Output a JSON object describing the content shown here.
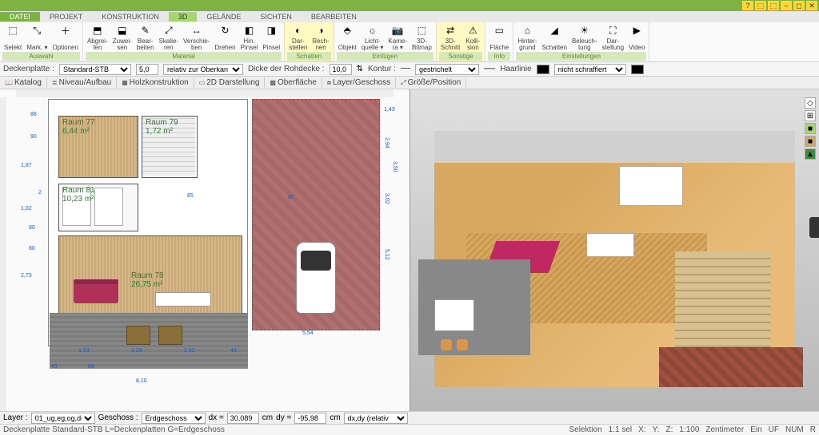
{
  "window_buttons": [
    "–",
    "◻",
    "✕"
  ],
  "menu_tabs": [
    {
      "label": "DATEI",
      "cls": "datei"
    },
    {
      "label": "PROJEKT"
    },
    {
      "label": "KONSTRUKTION"
    },
    {
      "label": "3D",
      "cls": "active"
    },
    {
      "label": "GELÄNDE"
    },
    {
      "label": "SICHTEN"
    },
    {
      "label": "BEARBEITEN"
    }
  ],
  "ribbon_groups": [
    {
      "name": "Auswahl",
      "buttons": [
        {
          "icon": "⬚",
          "label": "Selekt"
        },
        {
          "icon": "⤡",
          "label": "Mark. ▾"
        },
        {
          "icon": "＋",
          "label": "Optionen"
        }
      ]
    },
    {
      "name": "Material",
      "buttons": [
        {
          "icon": "⬒",
          "label": "Abgrei-\nfen"
        },
        {
          "icon": "⬓",
          "label": "Zuwei-\nsen"
        },
        {
          "icon": "✎",
          "label": "Bear-\nbeiten"
        },
        {
          "icon": "⤢",
          "label": "Skalie-\nren"
        },
        {
          "icon": "↔",
          "label": "Verschie-\nben"
        },
        {
          "icon": "↻",
          "label": "Drehen"
        },
        {
          "icon": "◧",
          "label": "Hin.\nPinsel"
        },
        {
          "icon": "◨",
          "label": "Pinsel"
        }
      ]
    },
    {
      "name": "Schatten",
      "hl": true,
      "buttons": [
        {
          "icon": "◐",
          "label": "Dar-\nstellen"
        },
        {
          "icon": "◑",
          "label": "Rech-\nnen"
        }
      ]
    },
    {
      "name": "Einfügen",
      "buttons": [
        {
          "icon": "⬘",
          "label": "Objekt"
        },
        {
          "icon": "☼",
          "label": "Licht-\nquelle ▾"
        },
        {
          "icon": "📷",
          "label": "Kame-\nra ▾"
        },
        {
          "icon": "⬚",
          "label": "3D-\nBitmap"
        }
      ]
    },
    {
      "name": "Sonstige",
      "hl": true,
      "buttons": [
        {
          "icon": "⇄",
          "label": "3D-\nSchnitt"
        },
        {
          "icon": "⚠",
          "label": "Kolli-\nsion"
        }
      ]
    },
    {
      "name": "Info",
      "buttons": [
        {
          "icon": "▭",
          "label": "Fläche"
        }
      ]
    },
    {
      "name": "Einstellungen",
      "buttons": [
        {
          "icon": "⌂",
          "label": "Hinter-\ngrund"
        },
        {
          "icon": "◢",
          "label": "Schatten"
        },
        {
          "icon": "☀",
          "label": "Beleuch-\ntung"
        },
        {
          "icon": "⛶",
          "label": "Dar-\nstellung"
        },
        {
          "icon": "▶",
          "label": "Video"
        }
      ]
    }
  ],
  "options_bar": {
    "decken_label": "Deckenplatte :",
    "decken_value": "Standard-STB",
    "height_value": "5,0",
    "relativ_label": "relativ zur Oberkan",
    "rohd_label": "Dicke der Rohdecke :",
    "rohd_value": "10,0",
    "kontur_label": "Kontur :",
    "kontur_value": "gestrichelt",
    "haar_label": "Haarlinie",
    "hatch_label": "nicht schraffiert"
  },
  "tab_bar": [
    {
      "icon": "📖",
      "label": "Katalog"
    },
    {
      "icon": "≣",
      "label": "Niveau/Aufbau"
    },
    {
      "icon": "▦",
      "label": "Holzkonstruktion"
    },
    {
      "icon": "▭",
      "label": "2D Darstellung"
    },
    {
      "icon": "▩",
      "label": "Oberfläche"
    },
    {
      "icon": "⧈",
      "label": "Layer/Geschoss"
    },
    {
      "icon": "⤢",
      "label": "Größe/Position"
    }
  ],
  "rooms": {
    "r77": {
      "name": "Raum 77",
      "area": "6,44 m²"
    },
    "r79": {
      "name": "Raum 79",
      "area": "1,72 m²"
    },
    "r81": {
      "name": "Raum 81",
      "area": "10,23 m²"
    },
    "r78": {
      "name": "Raum 78",
      "area": "26,75 m²"
    }
  },
  "dims_2d": {
    "d1": "88",
    "d2": "90",
    "d3": "1,87",
    "d4": "1,02",
    "d5": "2,73",
    "d6": "80",
    "d7": "80",
    "d8": "2",
    "garage_w": "5,54",
    "garage_h1": "2,94",
    "garage_h2": "3,50",
    "garage_h3": "3,02",
    "garage_h4": "5,12",
    "g143": "1,43",
    "g80": "80",
    "pat1": "1,53",
    "pat2": "2,28",
    "pat3": "2,63",
    "pat4": "43",
    "base": "8,10",
    "b43": "43",
    "b88": "88",
    "r85": "85"
  },
  "tool_strip": [
    {
      "color": "#fff",
      "icon": "◇"
    },
    {
      "color": "#fff",
      "icon": "⊞"
    },
    {
      "color": "#a5d76e",
      "icon": "■"
    },
    {
      "color": "#c9a876",
      "icon": "■"
    },
    {
      "color": "#388e3c",
      "icon": "▲"
    }
  ],
  "layer_bar": {
    "layer_label": "Layer :",
    "layer_value": "01_ug,eg,og,dg",
    "geschoss_label": "Geschoss :",
    "geschoss_value": "Erdgeschoss",
    "dx_label": "dx =",
    "dx_value": "30,089",
    "dy_label": "dy =",
    "dy_value": "-95,98",
    "unit": "cm",
    "dxdy_label": "dx,dy (relativ",
    "dxdy_value": ""
  },
  "status_bar": {
    "left": "Deckenplatte Standard-STB L=Deckenplatten G=Erdgeschoss",
    "sel": "Selektion",
    "ratio": "1:1 sel",
    "x": "X:",
    "y": "Y:",
    "z": "Z:",
    "scale": "1:100",
    "unit": "Zentimeter",
    "ein": "Ein",
    "uf": "UF",
    "num": "NUM",
    "r": "R"
  }
}
